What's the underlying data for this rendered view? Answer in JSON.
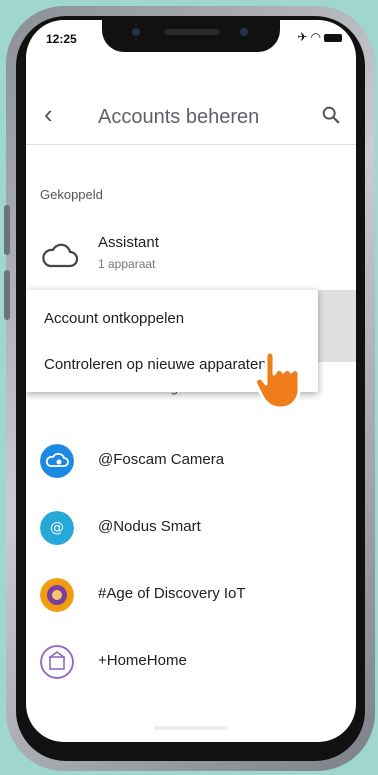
{
  "status": {
    "time": "12:25"
  },
  "appbar": {
    "title": "Accounts beheren"
  },
  "linked": {
    "section_label": "Gekoppeld",
    "account": {
      "name": "Assistant",
      "subtitle": "1 apparaat"
    }
  },
  "add_section": {
    "label": "Nieuwe service toevoegen"
  },
  "menu": {
    "items": [
      {
        "label": "Account ontkoppelen"
      },
      {
        "label": "Controleren op nieuwe apparaten"
      }
    ]
  },
  "services": [
    {
      "label": "@Foscam Camera",
      "icon": "cloud-camera-icon",
      "color": "#1e88e5"
    },
    {
      "label": "@Nodus Smart",
      "icon": "nodus-icon",
      "color": "#26a9d8"
    },
    {
      "label": "#Age of Discovery IoT",
      "icon": "aod-icon",
      "color": "#f39c12"
    },
    {
      "label": "+HomeHome",
      "icon": "homehome-icon",
      "color": "#8e6bc4"
    }
  ],
  "colors": {
    "background": "#9fd6cf",
    "pointer": "#ef7d1a"
  }
}
